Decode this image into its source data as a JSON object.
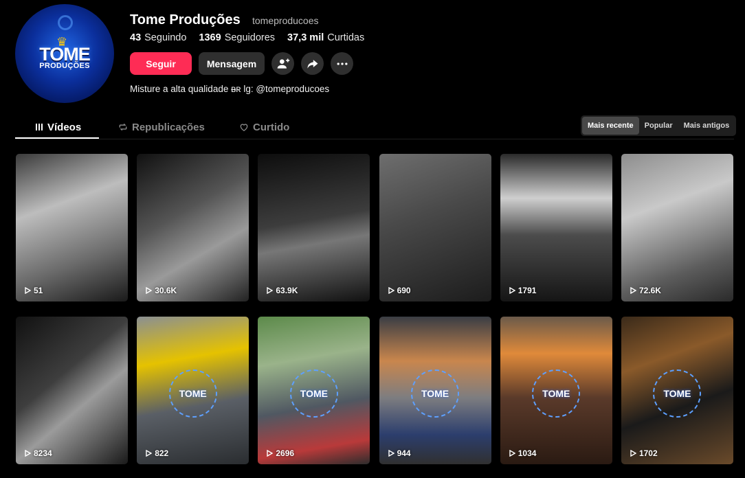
{
  "profile": {
    "display_name": "Tome Produções",
    "username": "tomeproducoes",
    "avatar": {
      "logo_main": "TOME",
      "logo_sub": "PRODUÇÕES"
    },
    "stats": [
      {
        "value": "43",
        "label": "Seguindo"
      },
      {
        "value": "1369",
        "label": "Seguidores"
      },
      {
        "value": "37,3 mil",
        "label": "Curtidas"
      }
    ],
    "bio": "Misture a alta qualidade ᴃʀ lg: @tomeproducoes"
  },
  "actions": {
    "follow_label": "Seguir",
    "message_label": "Mensagem",
    "icons": [
      "add-friend-icon",
      "share-icon",
      "more-icon"
    ]
  },
  "tabs": [
    {
      "label": "Vídeos",
      "icon": "grid-icon",
      "active": true
    },
    {
      "label": "Republicações",
      "icon": "repost-icon",
      "active": false
    },
    {
      "label": "Curtido",
      "icon": "heart-icon",
      "active": false
    }
  ],
  "sort": [
    {
      "label": "Mais recente",
      "active": true
    },
    {
      "label": "Popular",
      "active": false
    },
    {
      "label": "Mais antigos",
      "active": false
    }
  ],
  "videos": [
    {
      "views": "51",
      "tone": "gray"
    },
    {
      "views": "30.6K",
      "tone": "gray"
    },
    {
      "views": "63.9K",
      "tone": "gray"
    },
    {
      "views": "690",
      "tone": "gray"
    },
    {
      "views": "1791",
      "tone": "gray"
    },
    {
      "views": "72.6K",
      "tone": "gray"
    },
    {
      "views": "8234",
      "tone": "gray"
    },
    {
      "views": "822",
      "tone": "color",
      "watermark": "TOME"
    },
    {
      "views": "2696",
      "tone": "color",
      "watermark": "TOME"
    },
    {
      "views": "944",
      "tone": "color",
      "watermark": "TOME"
    },
    {
      "views": "1034",
      "tone": "color",
      "watermark": "TOME"
    },
    {
      "views": "1702",
      "tone": "color",
      "watermark": "TOME"
    }
  ],
  "colors": {
    "accent": "#fe2c55",
    "background": "#000000",
    "watermark_ring": "#5ea0ff"
  }
}
